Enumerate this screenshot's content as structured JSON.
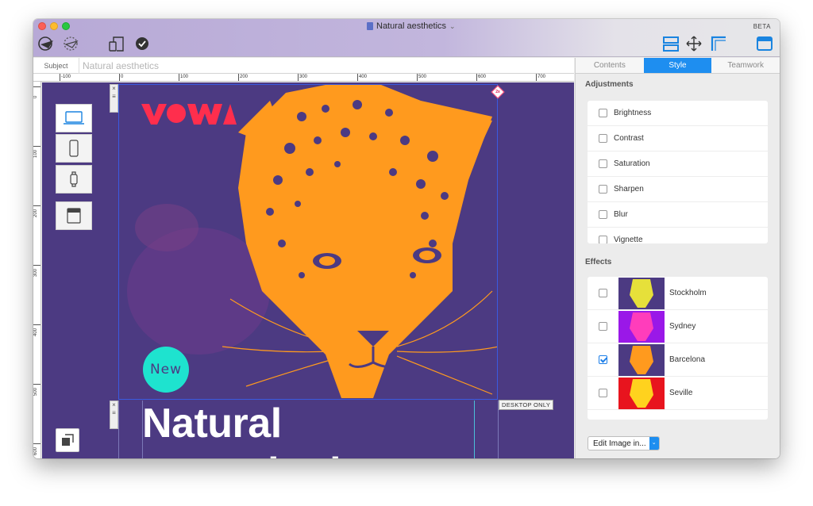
{
  "window": {
    "title": "Natural aesthetics",
    "beta_label": "BETA"
  },
  "toolbar": {
    "left_icons": [
      "send-icon",
      "schedule-icon",
      "devices-preview-icon",
      "checkmark-icon"
    ],
    "right_icons": [
      "layout-blocks-icon",
      "move-icon",
      "margins-icon",
      "panel-toggle-icon"
    ]
  },
  "subject": {
    "label": "Subject",
    "value": "Natural aesthetics"
  },
  "ruler": {
    "h_labels": [
      "-100",
      "0",
      "100",
      "200",
      "300",
      "400",
      "500",
      "600",
      "700"
    ],
    "v_labels": [
      "0",
      "100",
      "200",
      "300",
      "400",
      "500",
      "600"
    ]
  },
  "canvas": {
    "badge": "2x",
    "logo": "VOWA",
    "new_label": "New",
    "desktop_only": "DESKTOP ONLY",
    "headline": "Natural",
    "headline_partial": "aesthetics"
  },
  "devices": [
    "laptop-icon",
    "phone-icon",
    "watch-icon",
    "browser-icon"
  ],
  "tabs": {
    "contents": "Contents",
    "style": "Style",
    "teamwork": "Teamwork"
  },
  "adjustments": {
    "title": "Adjustments",
    "items": [
      {
        "label": "Brightness",
        "checked": false
      },
      {
        "label": "Contrast",
        "checked": false
      },
      {
        "label": "Saturation",
        "checked": false
      },
      {
        "label": "Sharpen",
        "checked": false
      },
      {
        "label": "Blur",
        "checked": false
      },
      {
        "label": "Vignette",
        "checked": false
      }
    ]
  },
  "effects": {
    "title": "Effects",
    "items": [
      {
        "label": "Stockholm",
        "checked": false,
        "bg": "#4c3a82",
        "fg": "#e6e03a"
      },
      {
        "label": "Sydney",
        "checked": false,
        "bg": "#9a18e8",
        "fg": "#ff3dbb"
      },
      {
        "label": "Barcelona",
        "checked": true,
        "bg": "#4c3a82",
        "fg": "#ff9a1e"
      },
      {
        "label": "Seville",
        "checked": false,
        "bg": "#e8141e",
        "fg": "#ffd21e"
      }
    ]
  },
  "edit_image": {
    "label": "Edit Image in..."
  },
  "colors": {
    "accent": "#1e8ef0",
    "canvas_bg": "#4c3a82",
    "leopard": "#ff9a1e",
    "logo": "#ff2e4d",
    "new_circle": "#1ee3cf"
  }
}
